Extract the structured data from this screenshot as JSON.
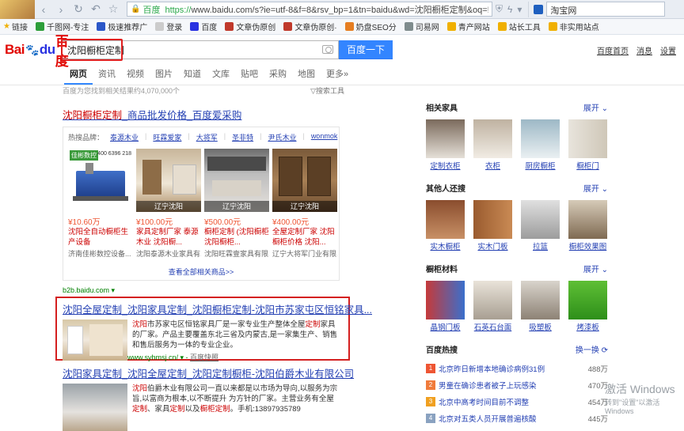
{
  "browser": {
    "address": {
      "site_label": "百度",
      "url_protocol": "https://",
      "url_rest": "www.baidu.com/s?ie=utf-8&f=8&rsv_bp=1&tn=baidu&wd=沈阳橱柜定制&oq=!"
    },
    "right_tab_label": "淘宝网",
    "bookmarks": [
      {
        "label": "链接",
        "color": "#f0b000"
      },
      {
        "label": "千图网-专注",
        "color": "#2d9e3a"
      },
      {
        "label": "极速推荐广",
        "color": "#2b57c8"
      },
      {
        "label": "登录",
        "color": "#888888"
      },
      {
        "label": "百度",
        "color": "#2932e1"
      },
      {
        "label": "文章伪原创",
        "color": "#c0392b"
      },
      {
        "label": "文章伪原创·",
        "color": "#c0392b"
      },
      {
        "label": "奶盘SEO分",
        "color": "#e67e22"
      },
      {
        "label": "司易网",
        "color": "#7f8c8d"
      },
      {
        "label": "青产网站",
        "color": "#f0b000"
      },
      {
        "label": "站长工具",
        "color": "#f0b000"
      },
      {
        "label": "非实用站点",
        "color": "#f0b000"
      }
    ]
  },
  "header": {
    "logo_left": "Bai",
    "logo_paw": "🐾",
    "logo_du": "du",
    "logo_right": "百度",
    "query": "沈阳橱柜定制",
    "search_button": "百度一下",
    "links": [
      "百度首页",
      "消息",
      "设置"
    ]
  },
  "tabs": [
    "网页",
    "资讯",
    "视频",
    "图片",
    "知道",
    "文库",
    "贴吧",
    "采购",
    "地图",
    "更多»"
  ],
  "results": {
    "stats": "百度为您找到相关结果约4,070,000个",
    "tools": "搜索工具",
    "shop": {
      "title_em": "沈阳橱柜定制",
      "title_rest": "_商品批发价格_百度爱采购",
      "brands_label": "热搜品牌：",
      "brands": [
        "泰源木业",
        "旺霖爱家",
        "大将军",
        "圣非特",
        "尹氏木业",
        "wonmok"
      ],
      "products": [
        {
          "price": "¥10.60万",
          "name_em": "沈阳",
          "name": "全自动橱柜生产设备",
          "desc": "济南佳彬数控设备...",
          "city": ""
        },
        {
          "price": "¥100.00元",
          "name_em": "",
          "name": "家具定制厂家 泰源木业 沈阳橱...",
          "desc": "沈阳泰源木业家具有...",
          "city": "辽宁沈阳"
        },
        {
          "price": "¥500.00元",
          "name_em": "",
          "name": "橱柜定制 (沈阳橱柜 沈阳橱柜...",
          "desc": "沈阳旺霖壹家具有限...",
          "city": "辽宁沈阳"
        },
        {
          "price": "¥400.00元",
          "name_em": "",
          "name": "全屋定制厂家 沈阳橱柜价格 沈阳...",
          "desc": "辽宁大将军门业有限...",
          "city": "辽宁沈阳"
        }
      ],
      "product_badge": "佳彬数控",
      "product_phone": "400 6396 218",
      "more": "查看全部相关商品>>",
      "source": "b2b.baidu.com"
    },
    "res2": {
      "title": "沈阳全屋定制_沈阳家具定制_沈阳橱柜定制-沈阳市苏家屯区恒铭家具...",
      "text_em1": "沈阳",
      "text_1": "市苏家屯区恒铭家具厂是一家专业生产整体全屋",
      "text_em2": "定制",
      "text_2": "家具的厂家。产品主要覆盖东北三省及内蒙古,是一家集生产、销售和售后服务为一体的专业企业。",
      "url": "www.syhmsj.cn/",
      "snapshot": "百度快照"
    },
    "res3": {
      "title": "沈阳家具定制_沈阳全屋定制_沈阳定制橱柜-沈阳伯爵木业有限公司",
      "text_em1": "沈阳",
      "text_1": "伯爵木业有限公司一直以来都是以市场为导向,以服务为宗旨,以富商为根本,以不断提升 为方针的厂家。主营业务有全屋",
      "text_em2": "定制",
      "text_2": "、家具",
      "text_em3": "定制",
      "text_3": "以及",
      "text_em4": "橱柜定制",
      "text_4": "。手机:13897935789"
    }
  },
  "sidebar": {
    "expand": "展开",
    "sections": [
      {
        "title": "相关家具",
        "items": [
          "定制衣柜",
          "衣柜",
          "厨房橱柜",
          "橱柜门"
        ]
      },
      {
        "title": "其他人还搜",
        "items": [
          "实木橱柜",
          "实木门板",
          "拉篮",
          "橱柜效果图"
        ]
      },
      {
        "title": "橱柜材料",
        "items": [
          "晶钢门板",
          "石英石台面",
          "吸塑板",
          "烤漆板"
        ]
      }
    ],
    "hot": {
      "title": "百度热搜",
      "refresh": "换一换",
      "items": [
        {
          "rank": "1",
          "text": "北京昨日新增本地确诊病例31例",
          "num": "488万",
          "color": "#e53"
        },
        {
          "rank": "2",
          "text": "男童在确诊患者被子上玩感染",
          "num": "470万",
          "color": "#f07b3b"
        },
        {
          "rank": "3",
          "text": "北京中高考时间目前不调整",
          "num": "454万",
          "color": "#f0a020"
        },
        {
          "rank": "4",
          "text": "北京对五类人员开展普遍核酸",
          "num": "445万",
          "color": "#8aa2c0"
        }
      ]
    }
  },
  "watermark": {
    "line1": "激活 Windows",
    "line2": "转到\"设置\"以激活 Windows"
  }
}
